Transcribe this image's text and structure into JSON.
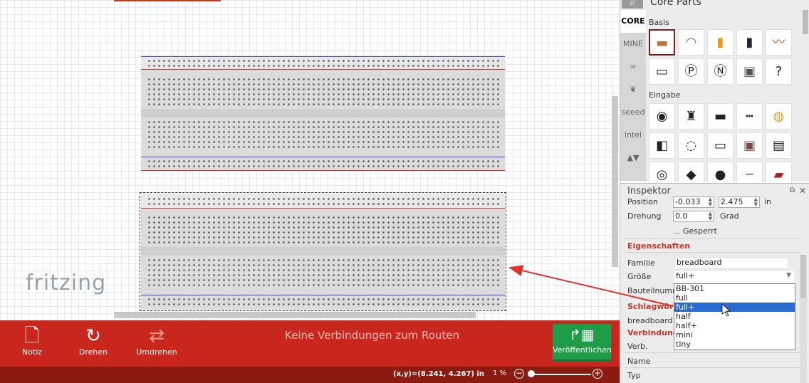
{
  "parts_panel": {
    "title": "Core Parts",
    "bins": [
      "CORE",
      "MINE",
      "∞",
      "❦",
      "seeed",
      "intel"
    ],
    "section_basis": "Basis",
    "section_eingabe": "Eingabe"
  },
  "canvas": {
    "logo": "fritzing"
  },
  "toolbar": {
    "note_label": "Notiz",
    "rotate_label": "Drehen",
    "flip_label": "Umdrehen",
    "status_message": "Keine Verbindungen zum Routen",
    "publish_label": "Veröffentlichen"
  },
  "statusbar": {
    "coords": "(x,y)=(8.241, 4.267) in",
    "zoom": "1 %",
    "zoom_level": 0.05
  },
  "inspector": {
    "title": "Inspektor",
    "position_label": "Position",
    "pos_x": "-0.033",
    "pos_y": "2.475",
    "pos_unit": "in",
    "rotation_label": "Drehung",
    "rotation": "0.0",
    "rotation_unit": "Grad",
    "locked_label": "Gesperrt",
    "properties_header": "Eigenschaften",
    "family_label": "Familie",
    "family_value": "breadboard",
    "size_label": "Größe",
    "size_value": "full+",
    "part_number_label": "Bauteilnumm",
    "keywords_header": "Schlagwörte",
    "keywords_value": "breadboard",
    "connections_header": "Verbindunge",
    "conn_label": "Verb.",
    "name_label": "Name",
    "type_label": "Typ",
    "size_options": [
      "BB-301",
      "full",
      "full+",
      "half",
      "half+",
      "mini",
      "tiny"
    ],
    "size_selected_index": 2
  }
}
